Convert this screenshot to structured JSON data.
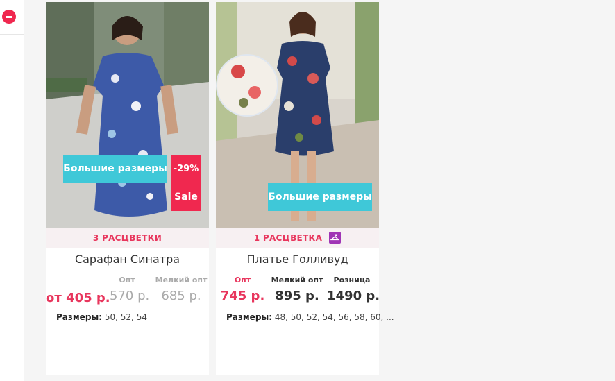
{
  "products": [
    {
      "badges": {
        "size": "Большие размеры",
        "discount": "-29%",
        "sale": "Sale"
      },
      "colors": "3 РАСЦВЕТКИ",
      "title": "Сарафан Синатра",
      "price_main": "от 405 р.",
      "price_labels": [
        "Опт",
        "Мелкий опт"
      ],
      "old_prices": [
        "570 р.",
        "685 р."
      ],
      "sizes_label": "Размеры:",
      "sizes_value": "50, 52, 54"
    },
    {
      "badges": {
        "size": "Большие размеры"
      },
      "colors": "1 РАСЦВЕТКА",
      "title": "Платье Голливуд",
      "price_labels": [
        "Опт",
        "Мелкий опт",
        "Розница"
      ],
      "prices": [
        "745 р.",
        "895 р.",
        "1490 р."
      ],
      "sizes_label": "Размеры:",
      "sizes_value": "48, 50, 52, 54, 56, 58, 60, ..."
    }
  ],
  "icons": [
    "remove-icon",
    "hanger-icon"
  ],
  "colors": {
    "accent_pink": "#e8365d",
    "badge_cyan": "#3fc8d8",
    "badge_red": "#f0284f",
    "hanger_purple": "#a035b5"
  }
}
